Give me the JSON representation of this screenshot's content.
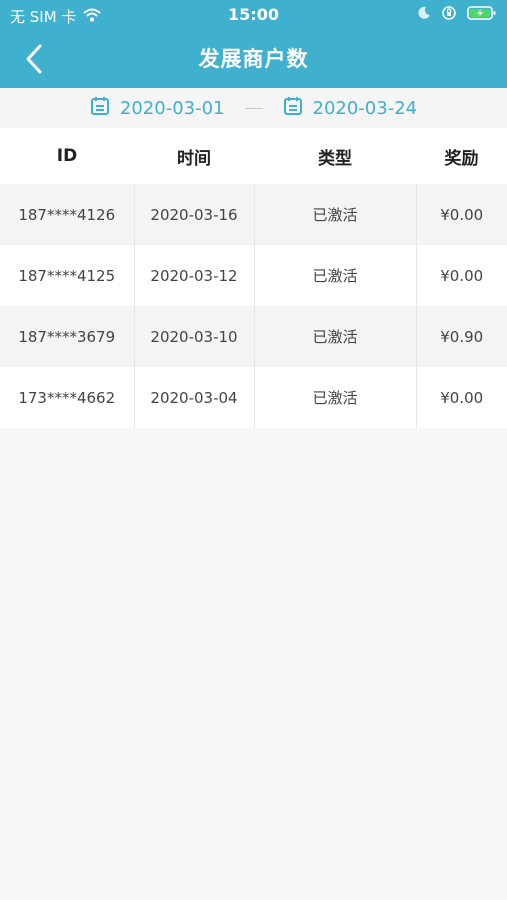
{
  "status": {
    "carrier": "无 SIM 卡",
    "time": "15:00"
  },
  "nav": {
    "title": "发展商户数"
  },
  "date_range": {
    "start": "2020-03-01",
    "end": "2020-03-24"
  },
  "table": {
    "headers": [
      "ID",
      "时间",
      "类型",
      "奖励"
    ],
    "rows": [
      [
        "187****4126",
        "2020-03-16",
        "已激活",
        "¥0.00"
      ],
      [
        "187****4125",
        "2020-03-12",
        "已激活",
        "¥0.00"
      ],
      [
        "187****3679",
        "2020-03-10",
        "已激活",
        "¥0.90"
      ],
      [
        "173****4662",
        "2020-03-04",
        "已激活",
        "¥0.00"
      ]
    ]
  },
  "colors": {
    "accent": "#3fb0cd"
  }
}
